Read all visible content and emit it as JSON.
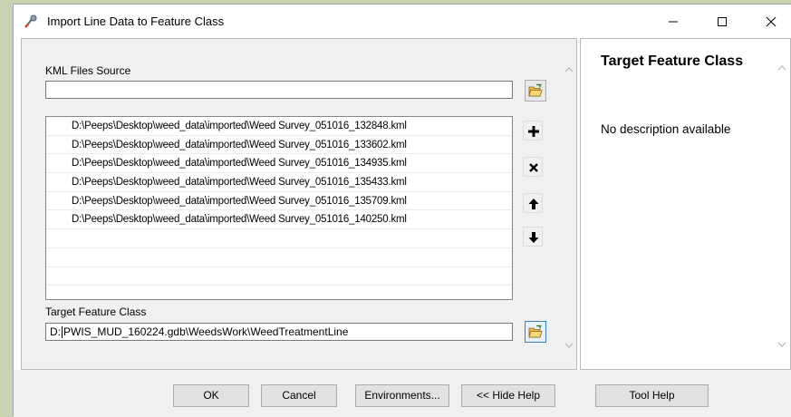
{
  "window": {
    "title": "Import Line Data to Feature Class",
    "controls": {
      "minimize": "minimize-icon",
      "maximize": "maximize-icon",
      "close": "close-icon"
    }
  },
  "form": {
    "kml_source_label": "KML Files Source",
    "kml_source_value": "",
    "kml_files": [
      "D:\\Peeps\\Desktop\\weed_data\\imported\\Weed Survey_051016_132848.kml",
      "D:\\Peeps\\Desktop\\weed_data\\imported\\Weed Survey_051016_133602.kml",
      "D:\\Peeps\\Desktop\\weed_data\\imported\\Weed Survey_051016_134935.kml",
      "D:\\Peeps\\Desktop\\weed_data\\imported\\Weed Survey_051016_135433.kml",
      "D:\\Peeps\\Desktop\\weed_data\\imported\\Weed Survey_051016_135709.kml",
      "D:\\Peeps\\Desktop\\weed_data\\imported\\Weed Survey_051016_140250.kml"
    ],
    "target_label": "Target Feature Class",
    "target_value_prefix": "D:",
    "target_value_rest": "PWIS_MUD_160224.gdb\\WeedsWork\\WeedTreatmentLine",
    "list_actions": [
      "add-icon",
      "remove-icon",
      "move-up-icon",
      "move-down-icon"
    ]
  },
  "help": {
    "title": "Target Feature Class",
    "description": "No description available"
  },
  "buttons": {
    "ok": "OK",
    "cancel": "Cancel",
    "environments": "Environments...",
    "hide_help": "<< Hide Help",
    "tool_help": "Tool Help"
  },
  "colors": {
    "desktop": "#c9d3b4",
    "panel": "#f0f0f0",
    "folder": "#e8b94a"
  }
}
